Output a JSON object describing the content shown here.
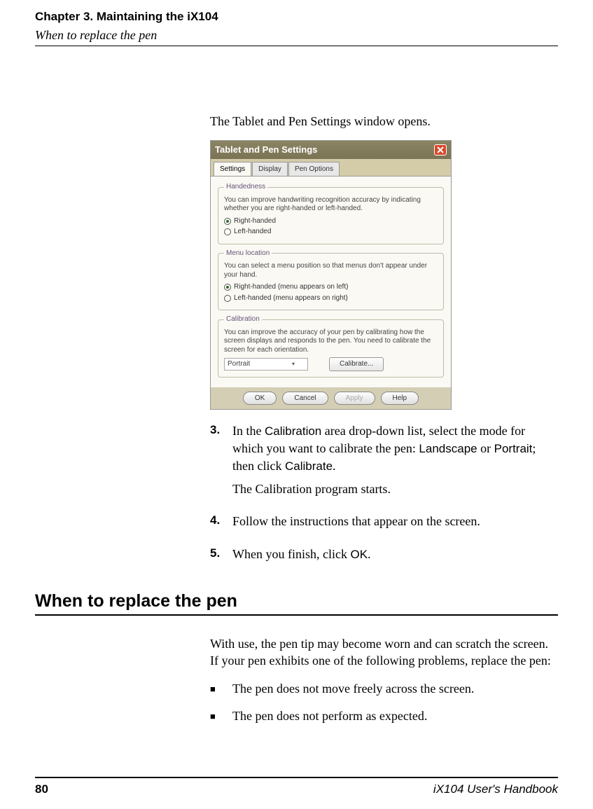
{
  "header": {
    "chapter": "Chapter 3. Maintaining the iX104",
    "section": "When to replace the pen"
  },
  "intro": "The Tablet and Pen Settings window opens.",
  "screenshot": {
    "title": "Tablet and Pen Settings",
    "tabs": {
      "settings": "Settings",
      "display": "Display",
      "pen_options": "Pen Options"
    },
    "handedness": {
      "legend": "Handedness",
      "desc": "You can improve handwriting recognition accuracy by indicating whether you are right-handed or left-handed.",
      "right": "Right-handed",
      "left": "Left-handed"
    },
    "menu_location": {
      "legend": "Menu location",
      "desc": "You can select a menu position so that menus don't appear under your hand.",
      "right": "Right-handed (menu appears on left)",
      "left": "Left-handed (menu appears on right)"
    },
    "calibration": {
      "legend": "Calibration",
      "desc": "You can improve the accuracy of your pen by calibrating how the screen displays and responds to the pen. You need to calibrate the screen for each orientation.",
      "select_value": "Portrait",
      "calibrate_btn": "Calibrate..."
    },
    "footer": {
      "ok": "OK",
      "cancel": "Cancel",
      "apply": "Apply",
      "help": "Help"
    }
  },
  "steps": {
    "s3_num": "3.",
    "s3_a_pre": "In the ",
    "s3_a_calibration": "Calibration",
    "s3_a_mid": " area drop-down list, select the mode for which you want to calibrate the pen: ",
    "s3_a_landscape": "Landscape",
    "s3_a_or": " or ",
    "s3_a_portrait": "Portrait",
    "s3_a_then": "; then click ",
    "s3_a_calibrate": "Calibrate",
    "s3_a_end": ".",
    "s3_b": "The Calibration program starts.",
    "s4_num": "4.",
    "s4": "Follow the instructions that appear on the screen.",
    "s5_num": "5.",
    "s5_pre": "When you finish, click ",
    "s5_ok": "OK",
    "s5_end": "."
  },
  "section2": {
    "heading": "When to replace the pen",
    "para": "With use, the pen tip may become worn and can scratch the screen. If your pen exhibits one of the following problems, replace the pen:",
    "b1": "The pen does not move freely across the screen.",
    "b2": "The pen does not perform as expected."
  },
  "footer": {
    "page": "80",
    "book": "iX104 User's Handbook"
  }
}
